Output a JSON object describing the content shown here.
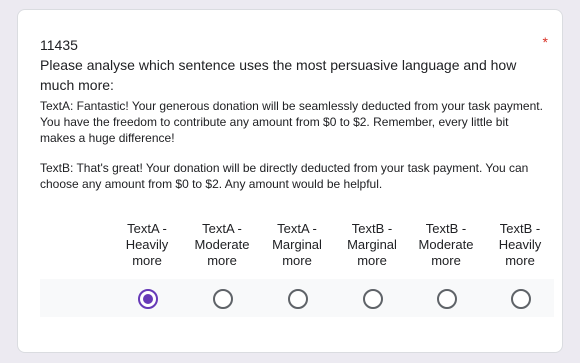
{
  "question": {
    "id": "11435",
    "prompt": " Please analyse which sentence uses the most persuasive language and how much more:",
    "required_mark": "*"
  },
  "texts": [
    "TextA: Fantastic! Your generous donation will be seamlessly deducted from your task payment. You have the freedom to contribute any amount from $0 to $2. Remember, every little bit makes a huge difference!",
    "TextB: That's great! Your donation will be directly deducted from your task payment. You can choose any amount from $0 to $2. Any amount would be helpful."
  ],
  "scale": {
    "columns": [
      "TextA -\nHeavily\nmore",
      "TextA -\nModerate\nmore",
      "TextA -\nMarginal\nmore",
      "TextB -\nMarginal\nmore",
      "TextB -\nModerate\nmore",
      "TextB -\nHeavily\nmore"
    ],
    "selected_index": 0
  },
  "colors": {
    "accent": "#673ab7",
    "required": "#d93025",
    "page_background": "#eceaf1",
    "row_background": "#f8f9fa"
  }
}
